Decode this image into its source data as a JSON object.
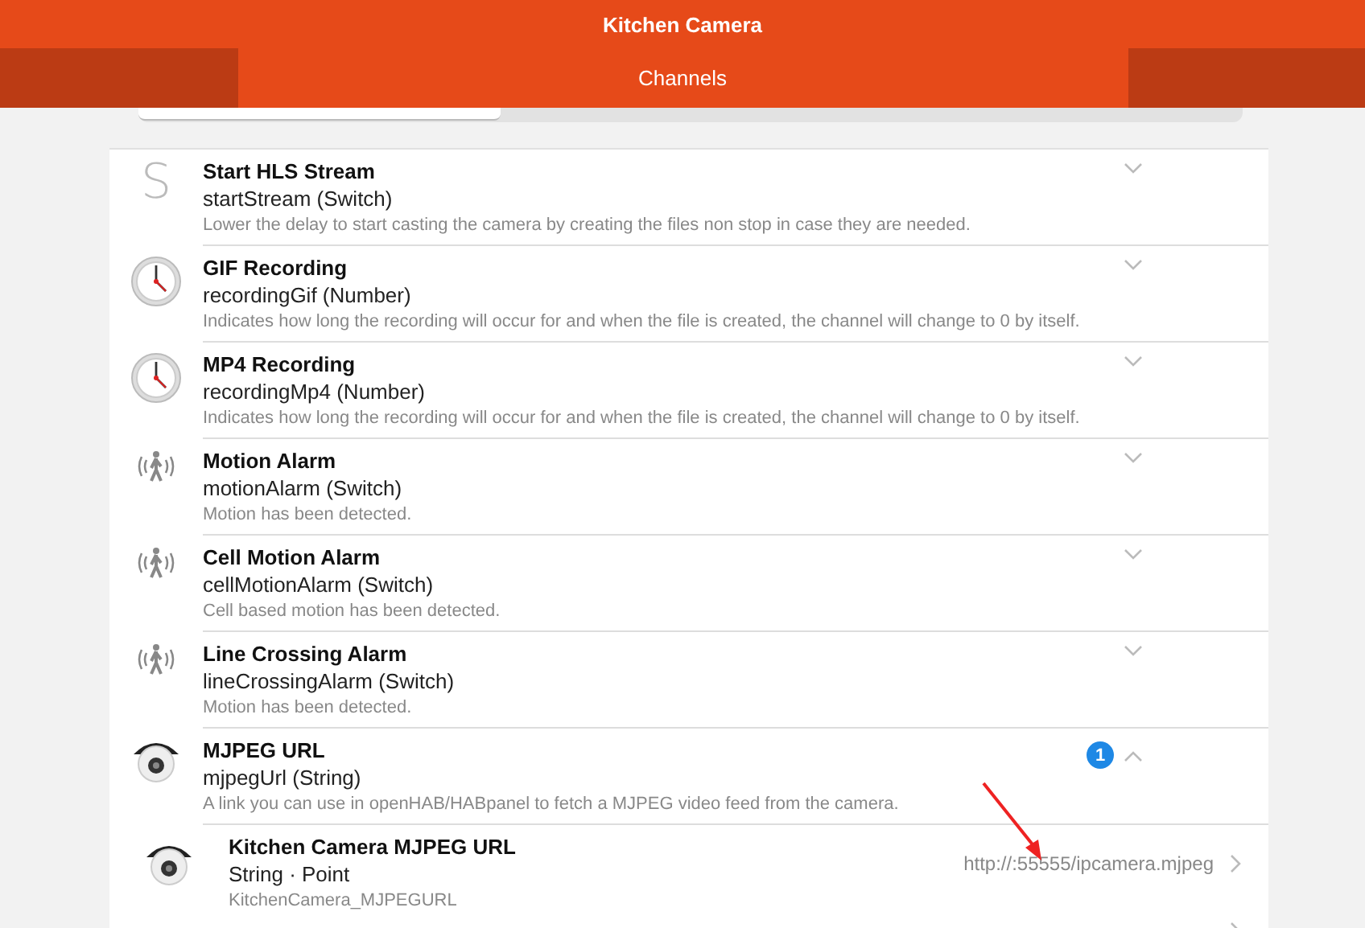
{
  "header": {
    "title": "Kitchen Camera"
  },
  "tabs": [
    {
      "label": "Channels",
      "selected": true
    }
  ],
  "channels": [
    {
      "kind": "letter",
      "letter": "S",
      "name": "Start HLS Stream",
      "id_type": "startStream (Switch)",
      "description": "Lower the delay to start casting the camera by creating the files non stop in case they are needed.",
      "expanded": false
    },
    {
      "kind": "clock",
      "name": "GIF Recording",
      "id_type": "recordingGif (Number)",
      "description": "Indicates how long the recording will occur for and when the file is created, the channel will change to 0 by itself.",
      "expanded": false
    },
    {
      "kind": "clock",
      "name": "MP4 Recording",
      "id_type": "recordingMp4 (Number)",
      "description": "Indicates how long the recording will occur for and when the file is created, the channel will change to 0 by itself.",
      "expanded": false
    },
    {
      "kind": "motion",
      "name": "Motion Alarm",
      "id_type": "motionAlarm (Switch)",
      "description": "Motion has been detected.",
      "expanded": false
    },
    {
      "kind": "motion",
      "name": "Cell Motion Alarm",
      "id_type": "cellMotionAlarm (Switch)",
      "description": "Cell based motion has been detected.",
      "expanded": false
    },
    {
      "kind": "motion",
      "name": "Line Crossing Alarm",
      "id_type": "lineCrossingAlarm (Switch)",
      "description": "Motion has been detected.",
      "expanded": false
    },
    {
      "kind": "camera",
      "name": "MJPEG URL",
      "id_type": "mjpegUrl (String)",
      "description": "A link you can use in openHAB/HABpanel to fetch a MJPEG video feed from the camera.",
      "expanded": true,
      "badge": "1",
      "links": [
        {
          "kind": "camera",
          "name": "Kitchen Camera MJPEG URL",
          "type": "String · Point",
          "item": "KitchenCamera_MJPEGURL",
          "value": "http://:55555/ipcamera.mjpeg"
        }
      ]
    }
  ]
}
